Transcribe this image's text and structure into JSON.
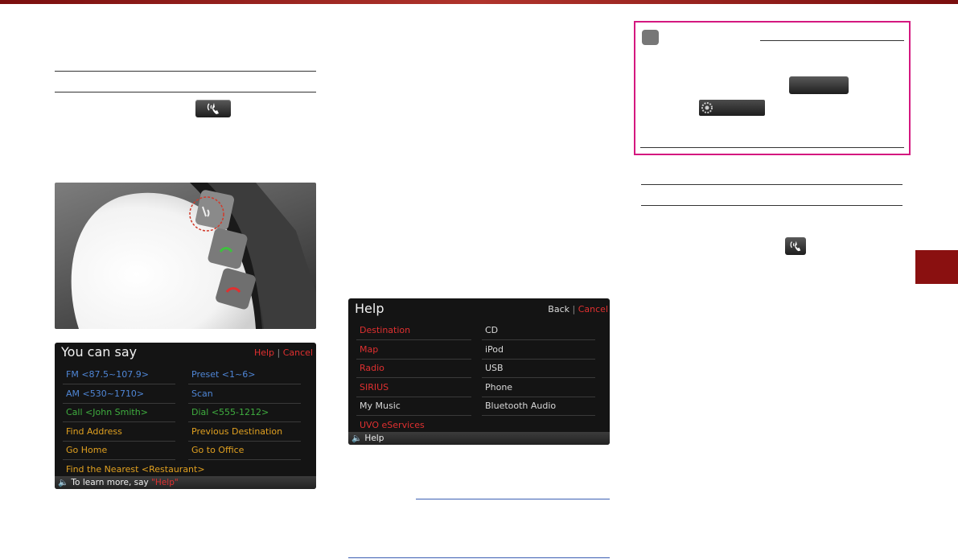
{
  "you_can_say_screen": {
    "title": "You can say",
    "help": "Help",
    "separator": "|",
    "cancel": "Cancel",
    "rows": [
      {
        "left": "FM <87.5~107.9>",
        "right": "Preset <1~6>",
        "left_color": "#4f86d6",
        "right_color": "#4f86d6"
      },
      {
        "left": "AM <530~1710>",
        "right": "Scan",
        "left_color": "#4f86d6",
        "right_color": "#4f86d6"
      },
      {
        "left": "Call <John Smith>",
        "right": "Dial <555-1212>",
        "left_color": "#3fae3f",
        "right_color": "#3fae3f"
      },
      {
        "left": "Find Address",
        "right": "Previous Destination",
        "left_color": "#e0a020",
        "right_color": "#e0a020"
      },
      {
        "left": "Go Home",
        "right": "Go to Office",
        "left_color": "#e0a020",
        "right_color": "#e0a020"
      },
      {
        "left": "Find the Nearest <Restaurant>",
        "right": "",
        "left_color": "#e0a020",
        "right_color": "#e0a020"
      }
    ],
    "footer_prefix": "To learn more, say ",
    "footer_help": "\"Help\""
  },
  "help_screen": {
    "title": "Help",
    "back": "Back",
    "separator": "|",
    "cancel": "Cancel",
    "left_items": [
      {
        "label": "Destination",
        "color": "#e03030"
      },
      {
        "label": "Map",
        "color": "#e03030"
      },
      {
        "label": "Radio",
        "color": "#e03030"
      },
      {
        "label": "SIRIUS",
        "color": "#e03030"
      },
      {
        "label": "My Music",
        "color": "#d8d8d8"
      },
      {
        "label": "UVO eServices",
        "color": "#e03030"
      }
    ],
    "right_items": [
      {
        "label": "CD",
        "color": "#d8d8d8"
      },
      {
        "label": "iPod",
        "color": "#d8d8d8"
      },
      {
        "label": "USB",
        "color": "#d8d8d8"
      },
      {
        "label": "Phone",
        "color": "#d8d8d8"
      },
      {
        "label": "Bluetooth Audio",
        "color": "#d8d8d8"
      }
    ],
    "footer": "Help"
  },
  "icons": {
    "talk": "voice-talk-icon",
    "speaker": "speaker-icon",
    "settings": "gear-icon"
  },
  "colors": {
    "accent_bar": "#8a1010",
    "note_border": "#d4187f",
    "on_screen_red": "#e03030"
  }
}
